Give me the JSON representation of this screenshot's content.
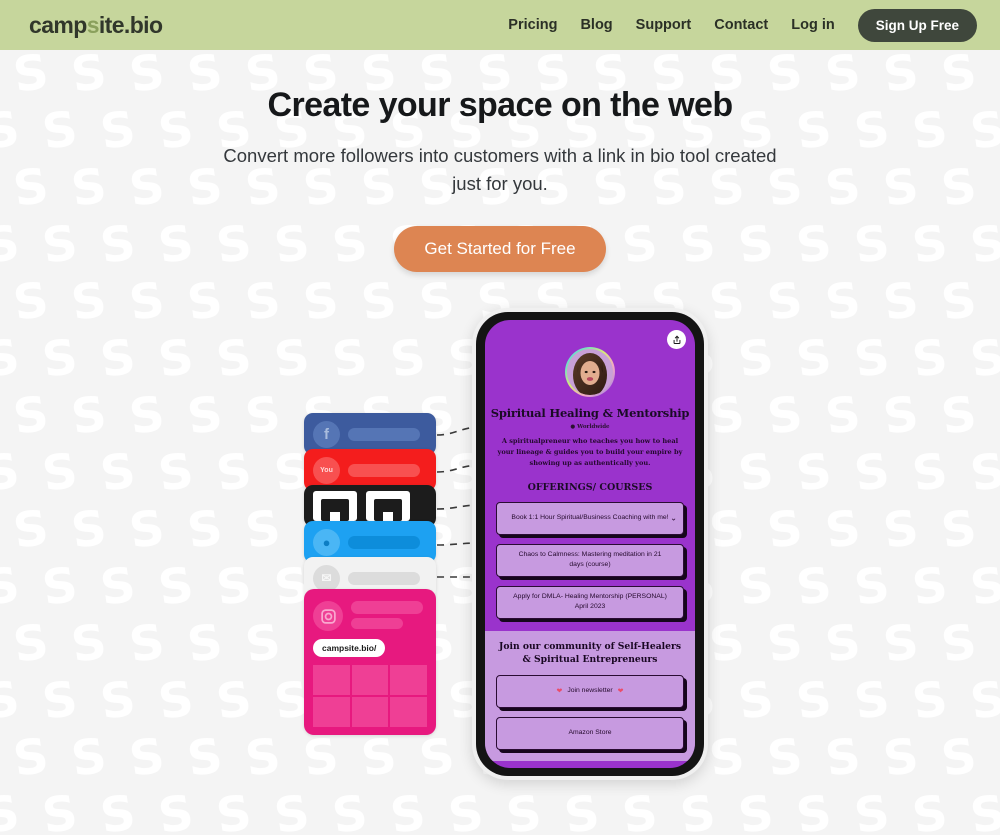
{
  "header": {
    "logo_text": "campsite.bio",
    "logo_prefix": "camp",
    "logo_accent": "s",
    "logo_suffix": "ite.bio",
    "nav": [
      {
        "label": "Pricing"
      },
      {
        "label": "Blog"
      },
      {
        "label": "Support"
      },
      {
        "label": "Contact"
      },
      {
        "label": "Log in"
      }
    ],
    "signup_label": "Sign Up Free",
    "bg_color": "#C6D69C",
    "signup_bg": "#3F473C"
  },
  "hero": {
    "title": "Create your space on the web",
    "subtitle": "Convert more followers into customers with a link in bio tool created just for you.",
    "cta_label": "Get Started for Free",
    "cta_color": "#DD8552"
  },
  "social_stack": {
    "cards": [
      {
        "name": "facebook",
        "icon": "f",
        "color": "#3D5B9E"
      },
      {
        "name": "youtube",
        "icon": "You",
        "color": "#F41D1D"
      },
      {
        "name": "tiktok",
        "icon": "tiktok",
        "color": "#1C1C1C"
      },
      {
        "name": "twitter",
        "icon": "bird",
        "color": "#1DA1F2"
      },
      {
        "name": "email",
        "icon": "envelope",
        "color": "#F2F2F2"
      },
      {
        "name": "instagram",
        "icon": "camera",
        "color": "#E7197F"
      }
    ],
    "instagram_badge": "campsite.bio/"
  },
  "phone": {
    "share_icon": "share-icon",
    "profile": {
      "name": "Spiritual Healing & Mentorship",
      "location": "Worldwide",
      "bio": "A spiritualpreneur who teaches you how to heal your lineage & guides you to build your empire by showing up as authentically you.",
      "bg_color": "#9A33CC"
    },
    "offerings_heading": "OFFERINGS/ COURSES",
    "links": [
      {
        "label": "Book 1:1 Hour Spiritual/Business Coaching with me!",
        "has_chevron": true
      },
      {
        "label": "Chaos to Calmness: Mastering meditation in 21 days (course)",
        "has_chevron": false
      },
      {
        "label": "Apply for DMLA- Healing Mentorship (PERSONAL) April 2023",
        "has_chevron": false
      }
    ],
    "community_heading": "Join our community of Self-Healers & Spiritual Entrepreneurs",
    "community_links": [
      {
        "label": "Join newsletter",
        "hearts": true
      },
      {
        "label": "Amazon Store",
        "hearts": false
      }
    ],
    "link_bg": "#C79AE0",
    "link_border": "#2A0B33"
  }
}
